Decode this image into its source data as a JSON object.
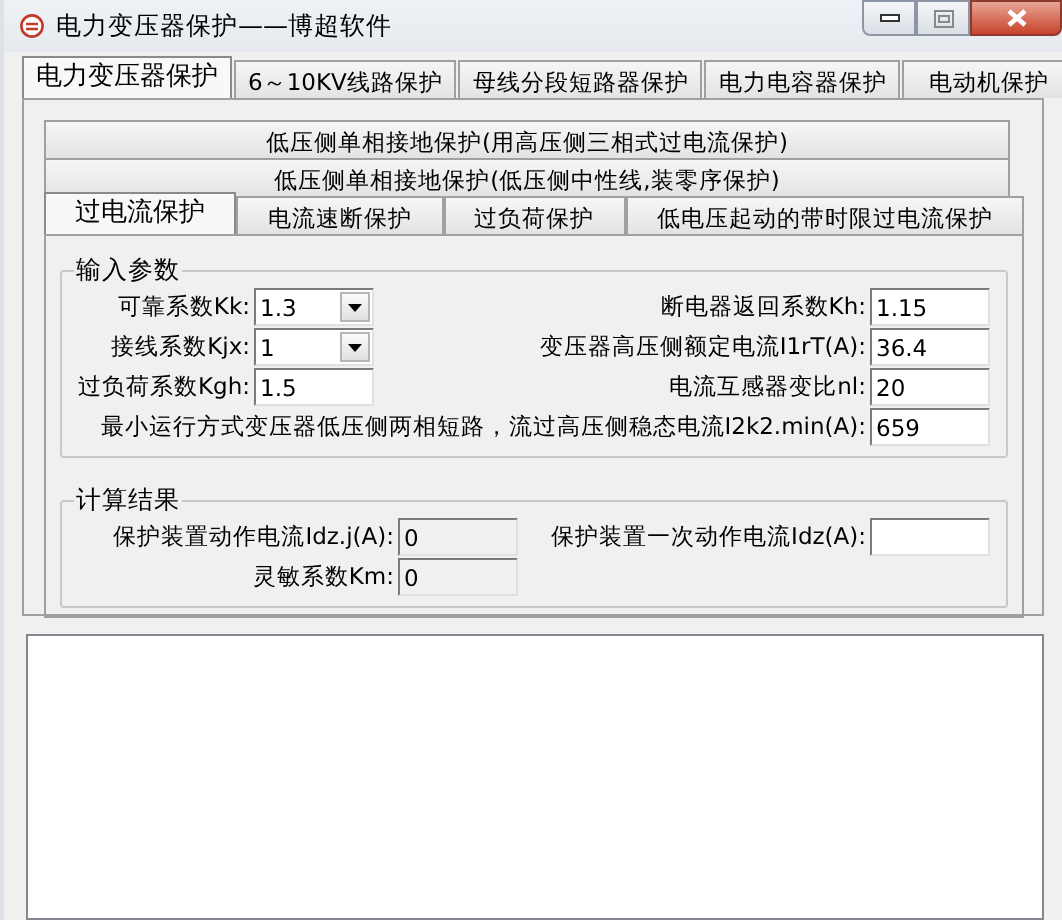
{
  "window": {
    "title": "电力变压器保护——博超软件"
  },
  "tabs": [
    {
      "label": "电力变压器保护",
      "selected": true
    },
    {
      "label": "6～10KV线路保护",
      "selected": false
    },
    {
      "label": "母线分段短路器保护",
      "selected": false
    },
    {
      "label": "电力电容器保护",
      "selected": false
    },
    {
      "label": "电动机保护",
      "selected": false
    }
  ],
  "subtab_rows": [
    [
      {
        "label": "低压侧单相接地保护(用高压侧三相式过电流保护)",
        "selected": false
      }
    ],
    [
      {
        "label": "低压侧单相接地保护(低压侧中性线,装零序保护)",
        "selected": false
      }
    ],
    [
      {
        "label": "过电流保护",
        "selected": true
      },
      {
        "label": "电流速断保护",
        "selected": false
      },
      {
        "label": "过负荷保护",
        "selected": false
      },
      {
        "label": "低电压起动的带时限过电流保护",
        "selected": false
      }
    ]
  ],
  "inputs": {
    "title": "输入参数",
    "rows": [
      {
        "left": {
          "label": "可靠系数Kk:",
          "value": "1.3",
          "kind": "combo",
          "disabled": false
        },
        "right": {
          "label": "断电器返回系数Kh:",
          "value": "1.15",
          "kind": "text",
          "disabled": false
        }
      },
      {
        "left": {
          "label": "接线系数Kjx:",
          "value": "1",
          "kind": "combo",
          "disabled": false
        },
        "right": {
          "label": "变压器高压侧额定电流I1rT(A):",
          "value": "36.4",
          "kind": "text",
          "disabled": false
        }
      },
      {
        "left": {
          "label": "过负荷系数Kgh:",
          "value": "1.5",
          "kind": "text",
          "disabled": false
        },
        "right": {
          "label": "电流互感器变比nl:",
          "value": "20",
          "kind": "text",
          "disabled": false
        }
      },
      {
        "right": {
          "label": "最小运行方式变压器低压侧两相短路，流过高压侧稳态电流I2k2.min(A):",
          "value": "659",
          "kind": "text",
          "disabled": false
        }
      }
    ]
  },
  "results": {
    "title": "计算结果",
    "rows": [
      {
        "left": {
          "label": "保护装置动作电流Idz.j(A):",
          "value": "0",
          "kind": "text",
          "disabled": true
        },
        "right": {
          "label": "保护装置一次动作电流Idz(A):",
          "kind": "text",
          "disabled": false
        }
      },
      {
        "left": {
          "label": "灵敏系数Km:",
          "value": "0",
          "kind": "text",
          "disabled": true
        }
      }
    ]
  }
}
